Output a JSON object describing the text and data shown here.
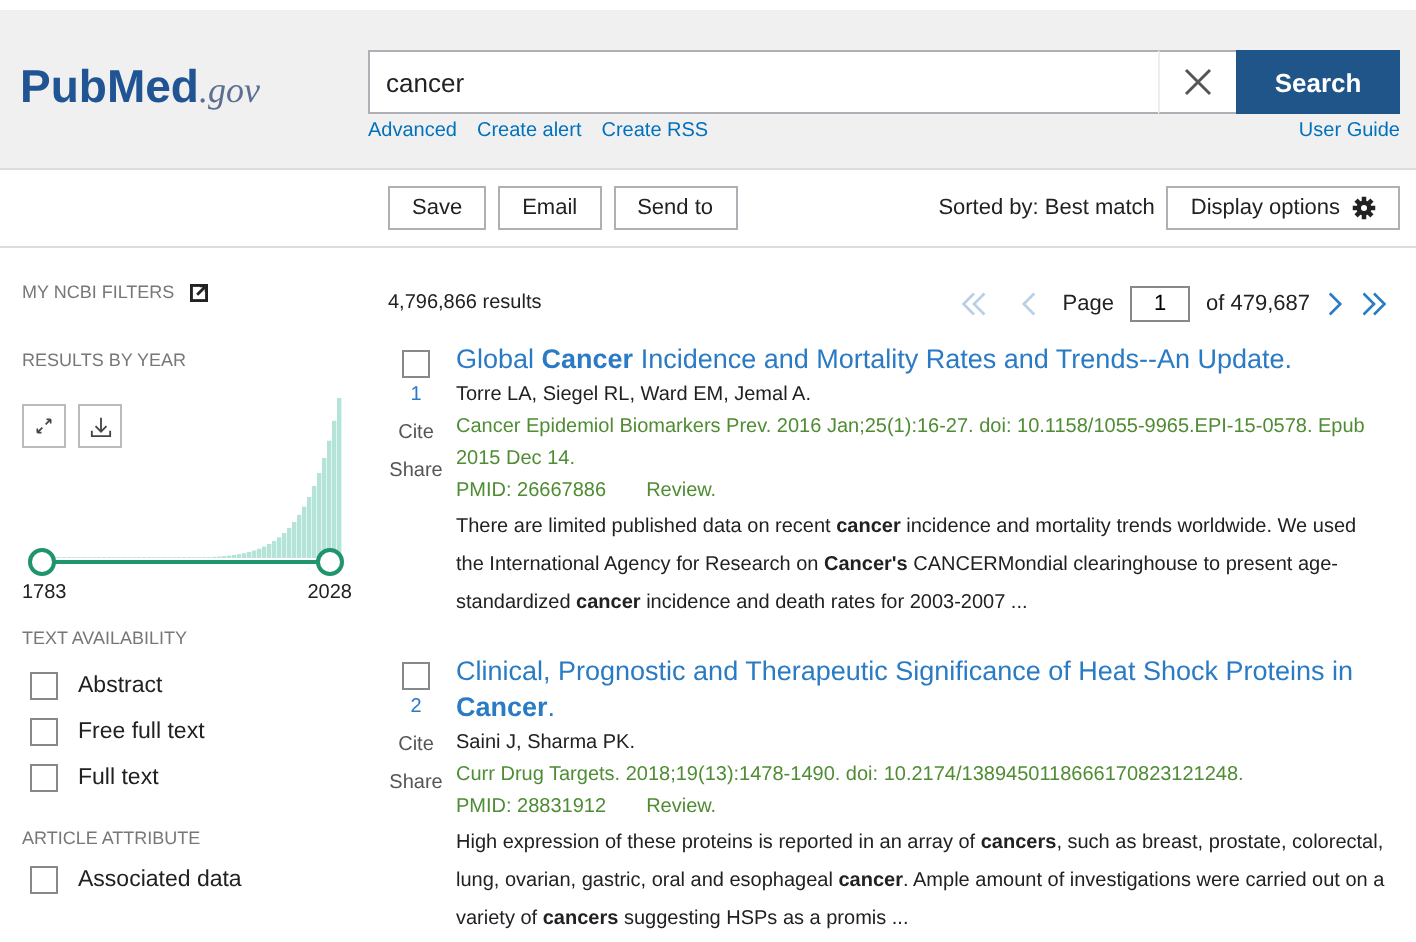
{
  "logo": {
    "name": "PubMed",
    "suffix": ".gov"
  },
  "search": {
    "value": "cancer",
    "button": "Search",
    "links": [
      "Advanced",
      "Create alert",
      "Create RSS"
    ],
    "guide": "User Guide"
  },
  "toolbar": {
    "actions": [
      "Save",
      "Email",
      "Send to"
    ],
    "sort": "Sorted by: Best match",
    "display": "Display options"
  },
  "sidebar": {
    "ncbi": "MY NCBI FILTERS",
    "years_heading": "RESULTS BY YEAR",
    "year_start": "1783",
    "year_end": "2028",
    "year_slider": {
      "low": {
        "level": 0
      },
      "high": {
        "level": 1
      }
    },
    "sections": [
      {
        "heading": "TEXT AVAILABILITY",
        "filters": [
          {
            "label": "Abstract",
            "checked": false
          },
          {
            "label": "Free full text",
            "checked": false
          },
          {
            "label": "Full text",
            "checked": false
          }
        ]
      },
      {
        "heading": "ARTICLE ATTRIBUTE",
        "filters": [
          {
            "label": "Associated data",
            "checked": false
          }
        ]
      }
    ]
  },
  "results": {
    "count": "4,796,866 results",
    "page_label": "Page",
    "page": "1",
    "page_total": "of 479,687",
    "items": [
      {
        "checked": false,
        "number": "1",
        "cite": "Cite",
        "share": "Share",
        "title": "Global **Cancer** Incidence and Mortality Rates and Trends--An Update.",
        "authors": "Torre LA, Siegel RL, Ward EM, Jemal A.",
        "citation": "Cancer Epidemiol Biomarkers Prev. 2016 Jan;25(1):16-27. doi: 10.1158/1055-9965.EPI-15-0578. Epub 2015 Dec 14.",
        "pmid": "PMID: 26667886",
        "type": "Review.",
        "snippet": "There are limited published data on recent **cancer** incidence and mortality trends worldwide. We used the International Agency for Research on **Cancer's** CANCERMondial clearinghouse to present age-standardized **cancer** incidence and death rates for 2003-2007 ..."
      },
      {
        "checked": false,
        "number": "2",
        "cite": "Cite",
        "share": "Share",
        "title": "Clinical, Prognostic and Therapeutic Significance of Heat Shock Proteins in **Cancer**.",
        "authors": "Saini J, Sharma PK.",
        "citation": "Curr Drug Targets. 2018;19(13):1478-1490. doi: 10.2174/1389450118666170823121248.",
        "pmid": "PMID: 28831912",
        "type": "Review.",
        "snippet": "High expression of these proteins is reported in an array of **cancers**, such as breast, prostate, colorectal, lung, ovarian, gastric, oral and esophageal **cancer**. Ample amount of investigations were carried out on a variety of **cancers** suggesting HSPs as a promis ..."
      }
    ]
  }
}
